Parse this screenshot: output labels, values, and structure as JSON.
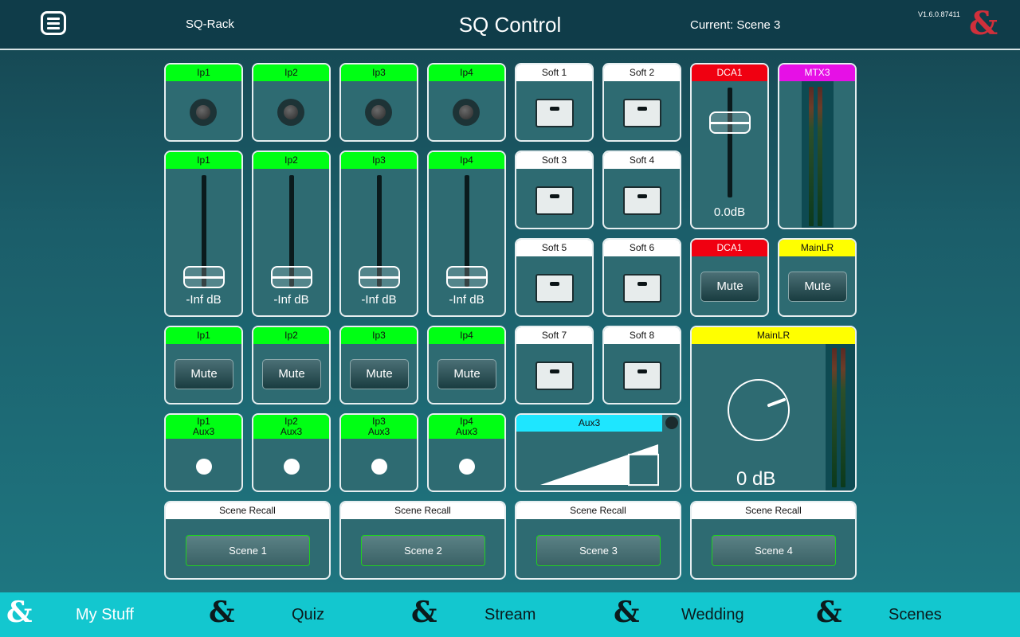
{
  "header": {
    "menu_icon": "hamburger-menu-icon",
    "device": "SQ-Rack",
    "title": "SQ Control",
    "current_scene": "Current: Scene 3",
    "version": "V1.6.0.87411",
    "logo_glyph": "&",
    "logo_color": "#d0303b"
  },
  "row1": {
    "leds": [
      {
        "label": "Ip1"
      },
      {
        "label": "Ip2"
      },
      {
        "label": "Ip3"
      },
      {
        "label": "Ip4"
      }
    ]
  },
  "faders": [
    {
      "label": "Ip1",
      "value": "-Inf dB",
      "level": 0.0
    },
    {
      "label": "Ip2",
      "value": "-Inf dB",
      "level": 0.0
    },
    {
      "label": "Ip3",
      "value": "-Inf dB",
      "level": 0.0
    },
    {
      "label": "Ip4",
      "value": "-Inf dB",
      "level": 0.0
    }
  ],
  "mutes": [
    {
      "label": "Ip1",
      "button": "Mute"
    },
    {
      "label": "Ip2",
      "button": "Mute"
    },
    {
      "label": "Ip3",
      "button": "Mute"
    },
    {
      "label": "Ip4",
      "button": "Mute"
    }
  ],
  "sends": [
    {
      "line1": "Ip1",
      "line2": "Aux3"
    },
    {
      "line1": "Ip2",
      "line2": "Aux3"
    },
    {
      "line1": "Ip3",
      "line2": "Aux3"
    },
    {
      "line1": "Ip4",
      "line2": "Aux3"
    }
  ],
  "softkeys": [
    "Soft 1",
    "Soft 2",
    "Soft 3",
    "Soft 4",
    "Soft 5",
    "Soft 6",
    "Soft 7",
    "Soft 8"
  ],
  "dca_fader": {
    "label": "DCA1",
    "value": "0.0dB",
    "level": 0.75,
    "color": "#f00011"
  },
  "mtx_meter": {
    "label": "MTX3",
    "color": "#e610e6"
  },
  "dca_mute": {
    "label": "DCA1",
    "button": "Mute"
  },
  "mainlr_mute": {
    "label": "MainLR",
    "button": "Mute"
  },
  "aux_master": {
    "label": "Aux3",
    "level": 0.75,
    "color": "#1ee6ff"
  },
  "main_knob": {
    "label": "MainLR",
    "value": "0 dB",
    "color": "#ffff00"
  },
  "scenes": [
    {
      "header": "Scene Recall",
      "button": "Scene 1"
    },
    {
      "header": "Scene Recall",
      "button": "Scene 2"
    },
    {
      "header": "Scene Recall",
      "button": "Scene 3"
    },
    {
      "header": "Scene Recall",
      "button": "Scene 4"
    }
  ],
  "bottom_nav": {
    "glyph": "&",
    "items": [
      {
        "label": "My Stuff",
        "selected": true
      },
      {
        "label": "Quiz",
        "selected": false
      },
      {
        "label": "Stream",
        "selected": false
      },
      {
        "label": "Wedding",
        "selected": false
      },
      {
        "label": "Scenes",
        "selected": false
      }
    ]
  }
}
